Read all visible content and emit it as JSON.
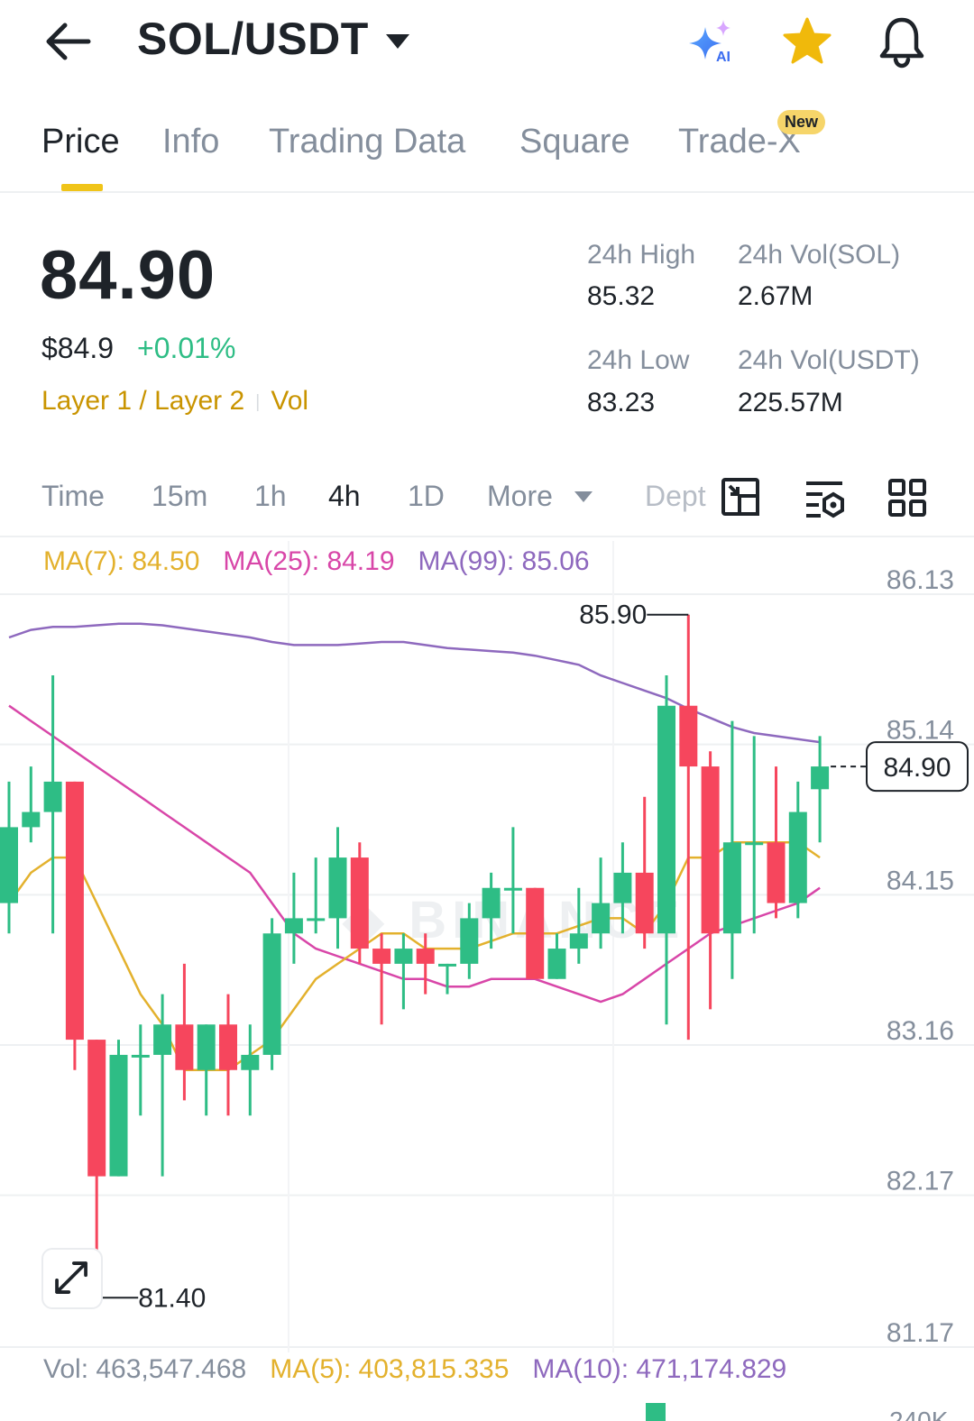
{
  "header": {
    "pair": "SOL/USDT",
    "icons": [
      "arrow-left-icon",
      "caret-down-icon",
      "ai-sparkle-icon",
      "star-icon",
      "bell-icon"
    ],
    "ai_label": "AI"
  },
  "tabs": [
    {
      "label": "Price",
      "active": true
    },
    {
      "label": "Info"
    },
    {
      "label": "Trading Data"
    },
    {
      "label": "Square"
    },
    {
      "label": "Trade-X",
      "badge": "New"
    }
  ],
  "summary": {
    "last_price": "84.90",
    "usd_price": "$84.9",
    "change": "+0.01%",
    "tag1": "Layer 1 / Layer 2",
    "tag2": "Vol",
    "high_label": "24h High",
    "high_value": "85.32",
    "vol_sol_label": "24h Vol(SOL)",
    "vol_sol_value": "2.67M",
    "low_label": "24h Low",
    "low_value": "83.23",
    "vol_usdt_label": "24h Vol(USDT)",
    "vol_usdt_value": "225.57M"
  },
  "intervals": {
    "time": "Time",
    "m15": "15m",
    "h1": "1h",
    "h4": "4h",
    "d1": "1D",
    "more": "More",
    "depth": "Dept",
    "active": "4h",
    "tool_icons": [
      "popout-icon",
      "indicator-settings-icon",
      "grid-layout-icon"
    ]
  },
  "ma": {
    "ma7": "MA(7): 84.50",
    "ma25": "MA(25): 84.19",
    "ma99": "MA(99): 85.06"
  },
  "volume": {
    "vol": "Vol: 463,547.468",
    "ma5": "MA(5): 403,815.335",
    "ma10": "MA(10): 471,174.829",
    "axis_label_partial": "240K"
  },
  "colors": {
    "up": "#2ebd85",
    "down": "#f6465d",
    "ma7": "#e3b12d",
    "ma25": "#d846a8",
    "ma99": "#8e69be",
    "accent": "#f0c419"
  },
  "chart_data": {
    "type": "candlestick",
    "y_ticks": [
      "86.13",
      "85.14",
      "84.15",
      "83.16",
      "82.17",
      "81.17"
    ],
    "ylim": [
      81.17,
      86.13
    ],
    "high_label": "85.90",
    "low_label": "81.40",
    "current_price_label": "84.90",
    "candles": [
      {
        "o": 84.0,
        "h": 84.8,
        "l": 83.8,
        "c": 84.5
      },
      {
        "o": 84.5,
        "h": 84.9,
        "l": 84.4,
        "c": 84.6
      },
      {
        "o": 84.6,
        "h": 85.5,
        "l": 83.8,
        "c": 84.8
      },
      {
        "o": 84.8,
        "h": 84.8,
        "l": 82.9,
        "c": 83.1
      },
      {
        "o": 83.1,
        "h": 83.1,
        "l": 81.4,
        "c": 82.2
      },
      {
        "o": 82.2,
        "h": 83.1,
        "l": 82.2,
        "c": 83.0
      },
      {
        "o": 83.0,
        "h": 83.2,
        "l": 82.6,
        "c": 83.0
      },
      {
        "o": 83.0,
        "h": 83.4,
        "l": 82.2,
        "c": 83.2
      },
      {
        "o": 83.2,
        "h": 83.6,
        "l": 82.7,
        "c": 82.9
      },
      {
        "o": 82.9,
        "h": 83.2,
        "l": 82.6,
        "c": 83.2
      },
      {
        "o": 83.2,
        "h": 83.4,
        "l": 82.6,
        "c": 82.9
      },
      {
        "o": 82.9,
        "h": 83.2,
        "l": 82.6,
        "c": 83.0
      },
      {
        "o": 83.0,
        "h": 83.9,
        "l": 82.9,
        "c": 83.8
      },
      {
        "o": 83.8,
        "h": 84.2,
        "l": 83.6,
        "c": 83.9
      },
      {
        "o": 83.9,
        "h": 84.3,
        "l": 83.8,
        "c": 83.9
      },
      {
        "o": 83.9,
        "h": 84.5,
        "l": 83.7,
        "c": 84.3
      },
      {
        "o": 84.3,
        "h": 84.4,
        "l": 83.6,
        "c": 83.7
      },
      {
        "o": 83.7,
        "h": 83.8,
        "l": 83.2,
        "c": 83.6
      },
      {
        "o": 83.6,
        "h": 83.8,
        "l": 83.3,
        "c": 83.7
      },
      {
        "o": 83.7,
        "h": 83.8,
        "l": 83.4,
        "c": 83.6
      },
      {
        "o": 83.6,
        "h": 83.6,
        "l": 83.4,
        "c": 83.6
      },
      {
        "o": 83.6,
        "h": 84.0,
        "l": 83.5,
        "c": 83.9
      },
      {
        "o": 83.9,
        "h": 84.2,
        "l": 83.7,
        "c": 84.1
      },
      {
        "o": 84.1,
        "h": 84.5,
        "l": 83.8,
        "c": 84.1
      },
      {
        "o": 84.1,
        "h": 84.1,
        "l": 83.5,
        "c": 83.5
      },
      {
        "o": 83.5,
        "h": 83.8,
        "l": 83.5,
        "c": 83.7
      },
      {
        "o": 83.7,
        "h": 84.1,
        "l": 83.6,
        "c": 83.8
      },
      {
        "o": 83.8,
        "h": 84.3,
        "l": 83.7,
        "c": 84.0
      },
      {
        "o": 84.0,
        "h": 84.4,
        "l": 83.8,
        "c": 84.2
      },
      {
        "o": 84.2,
        "h": 84.7,
        "l": 83.7,
        "c": 83.8
      },
      {
        "o": 83.8,
        "h": 85.5,
        "l": 83.2,
        "c": 85.3
      },
      {
        "o": 85.3,
        "h": 85.9,
        "l": 83.1,
        "c": 84.9
      },
      {
        "o": 84.9,
        "h": 85.0,
        "l": 83.3,
        "c": 83.8
      },
      {
        "o": 83.8,
        "h": 85.2,
        "l": 83.5,
        "c": 84.4
      },
      {
        "o": 84.4,
        "h": 85.1,
        "l": 83.8,
        "c": 84.4
      },
      {
        "o": 84.4,
        "h": 84.9,
        "l": 83.9,
        "c": 84.0
      },
      {
        "o": 84.0,
        "h": 84.8,
        "l": 83.9,
        "c": 84.6
      },
      {
        "o": 84.75,
        "h": 85.1,
        "l": 84.4,
        "c": 84.9
      }
    ],
    "ma7": [
      84.0,
      84.2,
      84.3,
      84.3,
      84.0,
      83.7,
      83.4,
      83.2,
      82.9,
      82.9,
      82.9,
      83.0,
      83.1,
      83.3,
      83.5,
      83.6,
      83.7,
      83.8,
      83.8,
      83.7,
      83.7,
      83.7,
      83.75,
      83.8,
      83.8,
      83.8,
      83.85,
      83.9,
      83.9,
      83.8,
      84.0,
      84.3,
      84.3,
      84.4,
      84.4,
      84.4,
      84.4,
      84.3
    ],
    "ma25": [
      85.3,
      85.2,
      85.1,
      85.0,
      84.9,
      84.8,
      84.7,
      84.6,
      84.5,
      84.4,
      84.3,
      84.2,
      84.0,
      83.8,
      83.7,
      83.65,
      83.6,
      83.55,
      83.5,
      83.5,
      83.45,
      83.45,
      83.5,
      83.5,
      83.5,
      83.45,
      83.4,
      83.35,
      83.4,
      83.5,
      83.6,
      83.7,
      83.8,
      83.85,
      83.9,
      83.95,
      84.0,
      84.1
    ],
    "ma99": [
      85.75,
      85.8,
      85.82,
      85.82,
      85.83,
      85.84,
      85.84,
      85.83,
      85.81,
      85.79,
      85.77,
      85.75,
      85.72,
      85.7,
      85.7,
      85.7,
      85.71,
      85.72,
      85.72,
      85.7,
      85.68,
      85.67,
      85.66,
      85.65,
      85.63,
      85.6,
      85.57,
      85.5,
      85.45,
      85.4,
      85.35,
      85.28,
      85.22,
      85.16,
      85.12,
      85.1,
      85.08,
      85.06
    ]
  }
}
